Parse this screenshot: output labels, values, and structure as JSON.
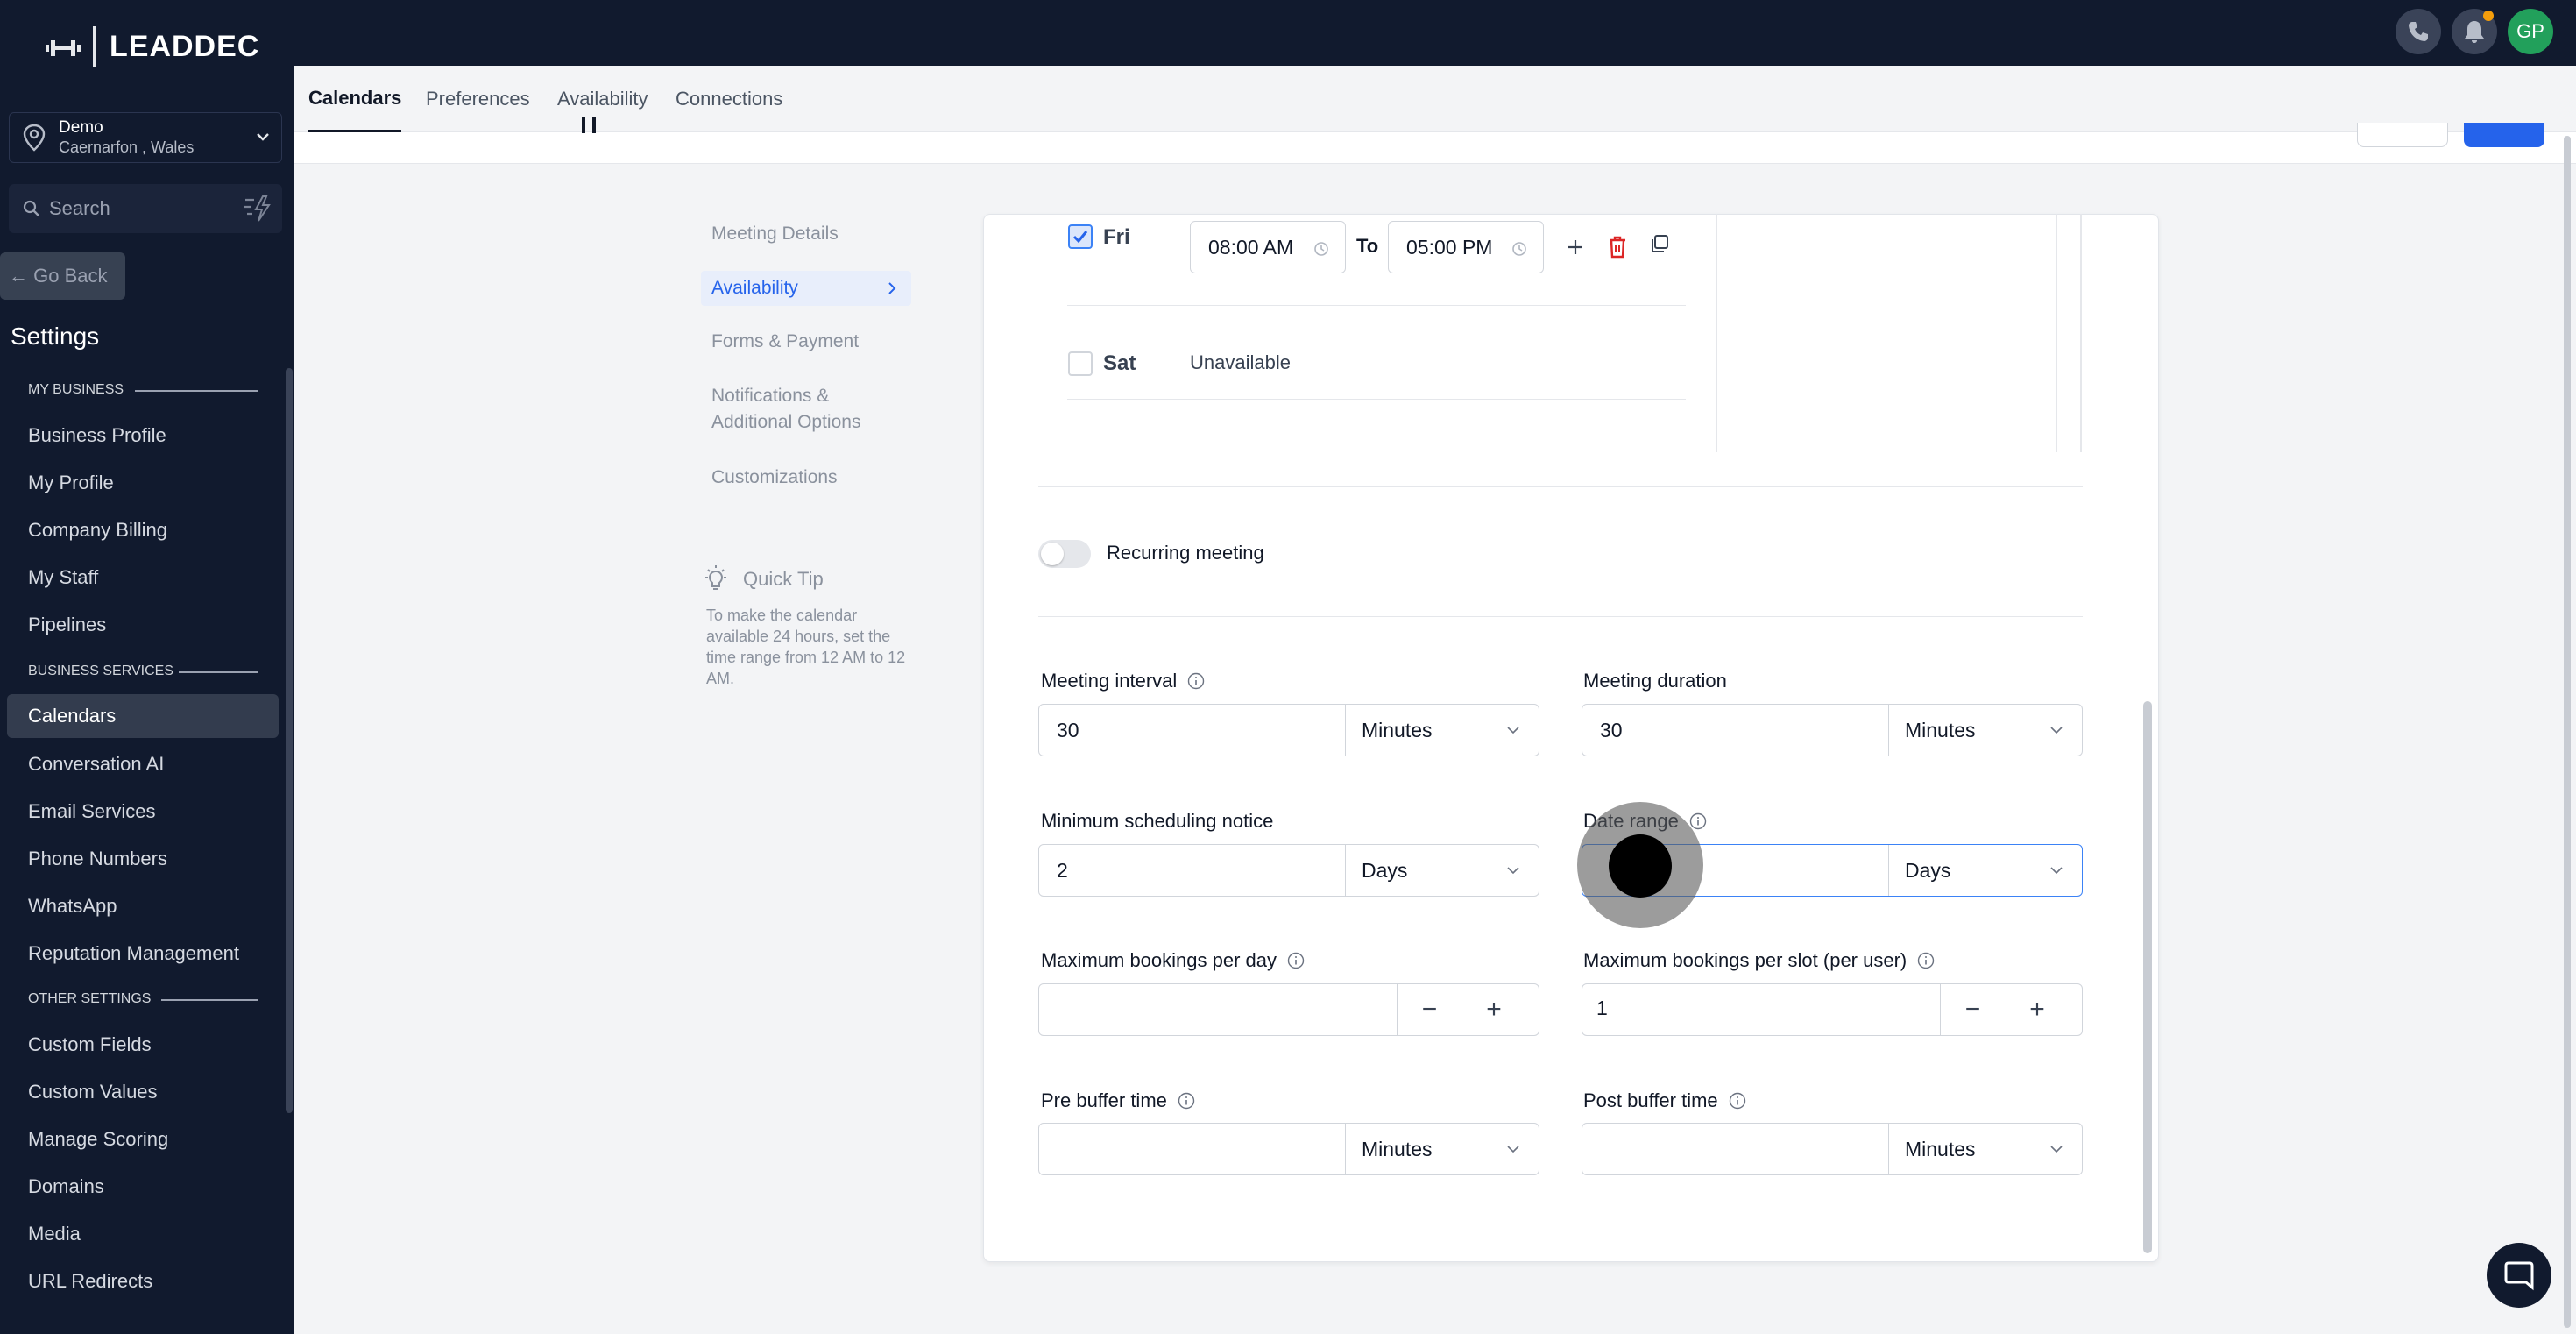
{
  "brand": {
    "name": "LEADDEC"
  },
  "location": {
    "name": "Demo",
    "sub": "Caernarfon , Wales"
  },
  "search": {
    "placeholder": "Search"
  },
  "sidebar": {
    "go_back": "← Go Back",
    "title": "Settings",
    "sections": {
      "my_business": "MY BUSINESS",
      "business_services": "BUSINESS SERVICES",
      "other_settings": "OTHER SETTINGS"
    },
    "items": [
      "Business Profile",
      "My Profile",
      "Company Billing",
      "My Staff",
      "Pipelines",
      "Calendars",
      "Conversation AI",
      "Email Services",
      "Phone Numbers",
      "WhatsApp",
      "Reputation Management",
      "Custom Fields",
      "Custom Values",
      "Manage Scoring",
      "Domains",
      "Media",
      "URL Redirects"
    ],
    "active_item": "Calendars"
  },
  "topbar": {
    "avatar_initials": "GP",
    "accent": "#f59e0b",
    "avatar_color": "#22a05b"
  },
  "tabs": [
    "Calendars",
    "Preferences",
    "Availability",
    "Connections"
  ],
  "steps": {
    "items": [
      "Meeting Details",
      "Availability",
      "Forms & Payment",
      "Notifications &",
      "Additional Options",
      "Customizations"
    ],
    "active": "Availability"
  },
  "tip": {
    "title": "Quick Tip",
    "text": "To make the calendar available 24 hours, set the time range from 12 AM to 12 AM."
  },
  "schedule": {
    "fri": {
      "day": "Fri",
      "checked": true,
      "from": "08:00 AM",
      "to_label": "To",
      "to": "05:00 PM"
    },
    "sat": {
      "day": "Sat",
      "checked": false,
      "status": "Unavailable"
    }
  },
  "recurring": {
    "label": "Recurring meeting",
    "enabled": false
  },
  "form": {
    "meeting_interval": {
      "label": "Meeting interval",
      "value": "30",
      "unit": "Minutes"
    },
    "meeting_duration": {
      "label": "Meeting duration",
      "value": "30",
      "unit": "Minutes"
    },
    "min_notice": {
      "label": "Minimum scheduling notice",
      "value": "2",
      "unit": "Days"
    },
    "date_range": {
      "label": "Date range",
      "value": "",
      "unit": "Days"
    },
    "max_per_day": {
      "label": "Maximum bookings per day",
      "value": ""
    },
    "max_per_slot": {
      "label": "Maximum bookings per slot (per user)",
      "value": "1"
    },
    "pre_buffer": {
      "label": "Pre buffer time",
      "value": "",
      "unit": "Minutes"
    },
    "post_buffer": {
      "label": "Post buffer time",
      "value": "",
      "unit": "Minutes"
    },
    "minus": "−",
    "plus": "+"
  },
  "colors": {
    "sidebar_bg": "#111a2e",
    "primary": "#2563eb",
    "delete": "#dc2626"
  }
}
